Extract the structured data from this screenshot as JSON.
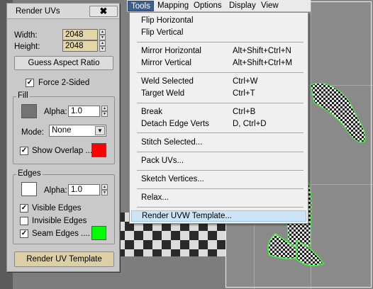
{
  "panel": {
    "title": "Render UVs",
    "close_glyph": "✖",
    "width_label": "Width:",
    "width_value": "2048",
    "height_label": "Height:",
    "height_value": "2048",
    "guess_aspect_label": "Guess Aspect Ratio",
    "force_2sided_label": "Force 2-Sided",
    "force_2sided_checked": "✓",
    "fill": {
      "group_label": "Fill",
      "alpha_label": "Alpha:",
      "alpha_value": "1.0",
      "mode_label": "Mode:",
      "mode_value": "None",
      "show_overlap_label": "Show Overlap ...",
      "show_overlap_checked": "✓",
      "fill_color": "#737373",
      "overlap_color": "#ff0000"
    },
    "edges": {
      "group_label": "Edges",
      "alpha_label": "Alpha:",
      "alpha_value": "1.0",
      "edge_color": "#ffffff",
      "visible_edges_label": "Visible Edges",
      "visible_edges_checked": "✓",
      "invisible_edges_label": "Invisible Edges",
      "seam_edges_label": "Seam Edges ....",
      "seam_edges_checked": "✓",
      "seam_color": "#00ff00"
    },
    "render_button_label": "Render UV Template"
  },
  "menubar": {
    "items": [
      "Tools",
      "Mapping",
      "Options",
      "Display",
      "View"
    ],
    "active": "Tools"
  },
  "tools_menu": {
    "items": [
      {
        "label": "Flip Horizontal",
        "shortcut": ""
      },
      {
        "label": "Flip Vertical",
        "shortcut": ""
      },
      {
        "label": "Mirror Horizontal",
        "shortcut": "Alt+Shift+Ctrl+N"
      },
      {
        "label": "Mirror Vertical",
        "shortcut": "Alt+Shift+Ctrl+M"
      },
      {
        "label": "Weld Selected",
        "shortcut": "Ctrl+W"
      },
      {
        "label": "Target Weld",
        "shortcut": "Ctrl+T"
      },
      {
        "label": "Break",
        "shortcut": "Ctrl+B"
      },
      {
        "label": "Detach Edge Verts",
        "shortcut": "D, Ctrl+D"
      },
      {
        "label": "Stitch Selected...",
        "shortcut": ""
      },
      {
        "label": "Pack UVs...",
        "shortcut": ""
      },
      {
        "label": "Sketch Vertices...",
        "shortcut": ""
      },
      {
        "label": "Relax...",
        "shortcut": ""
      },
      {
        "label": "Render UVW Template...",
        "shortcut": ""
      }
    ],
    "highlighted": "Render UVW Template..."
  },
  "colors": {
    "menu_highlight": "#cce4f5",
    "active_menu": "#3d5f8f"
  }
}
